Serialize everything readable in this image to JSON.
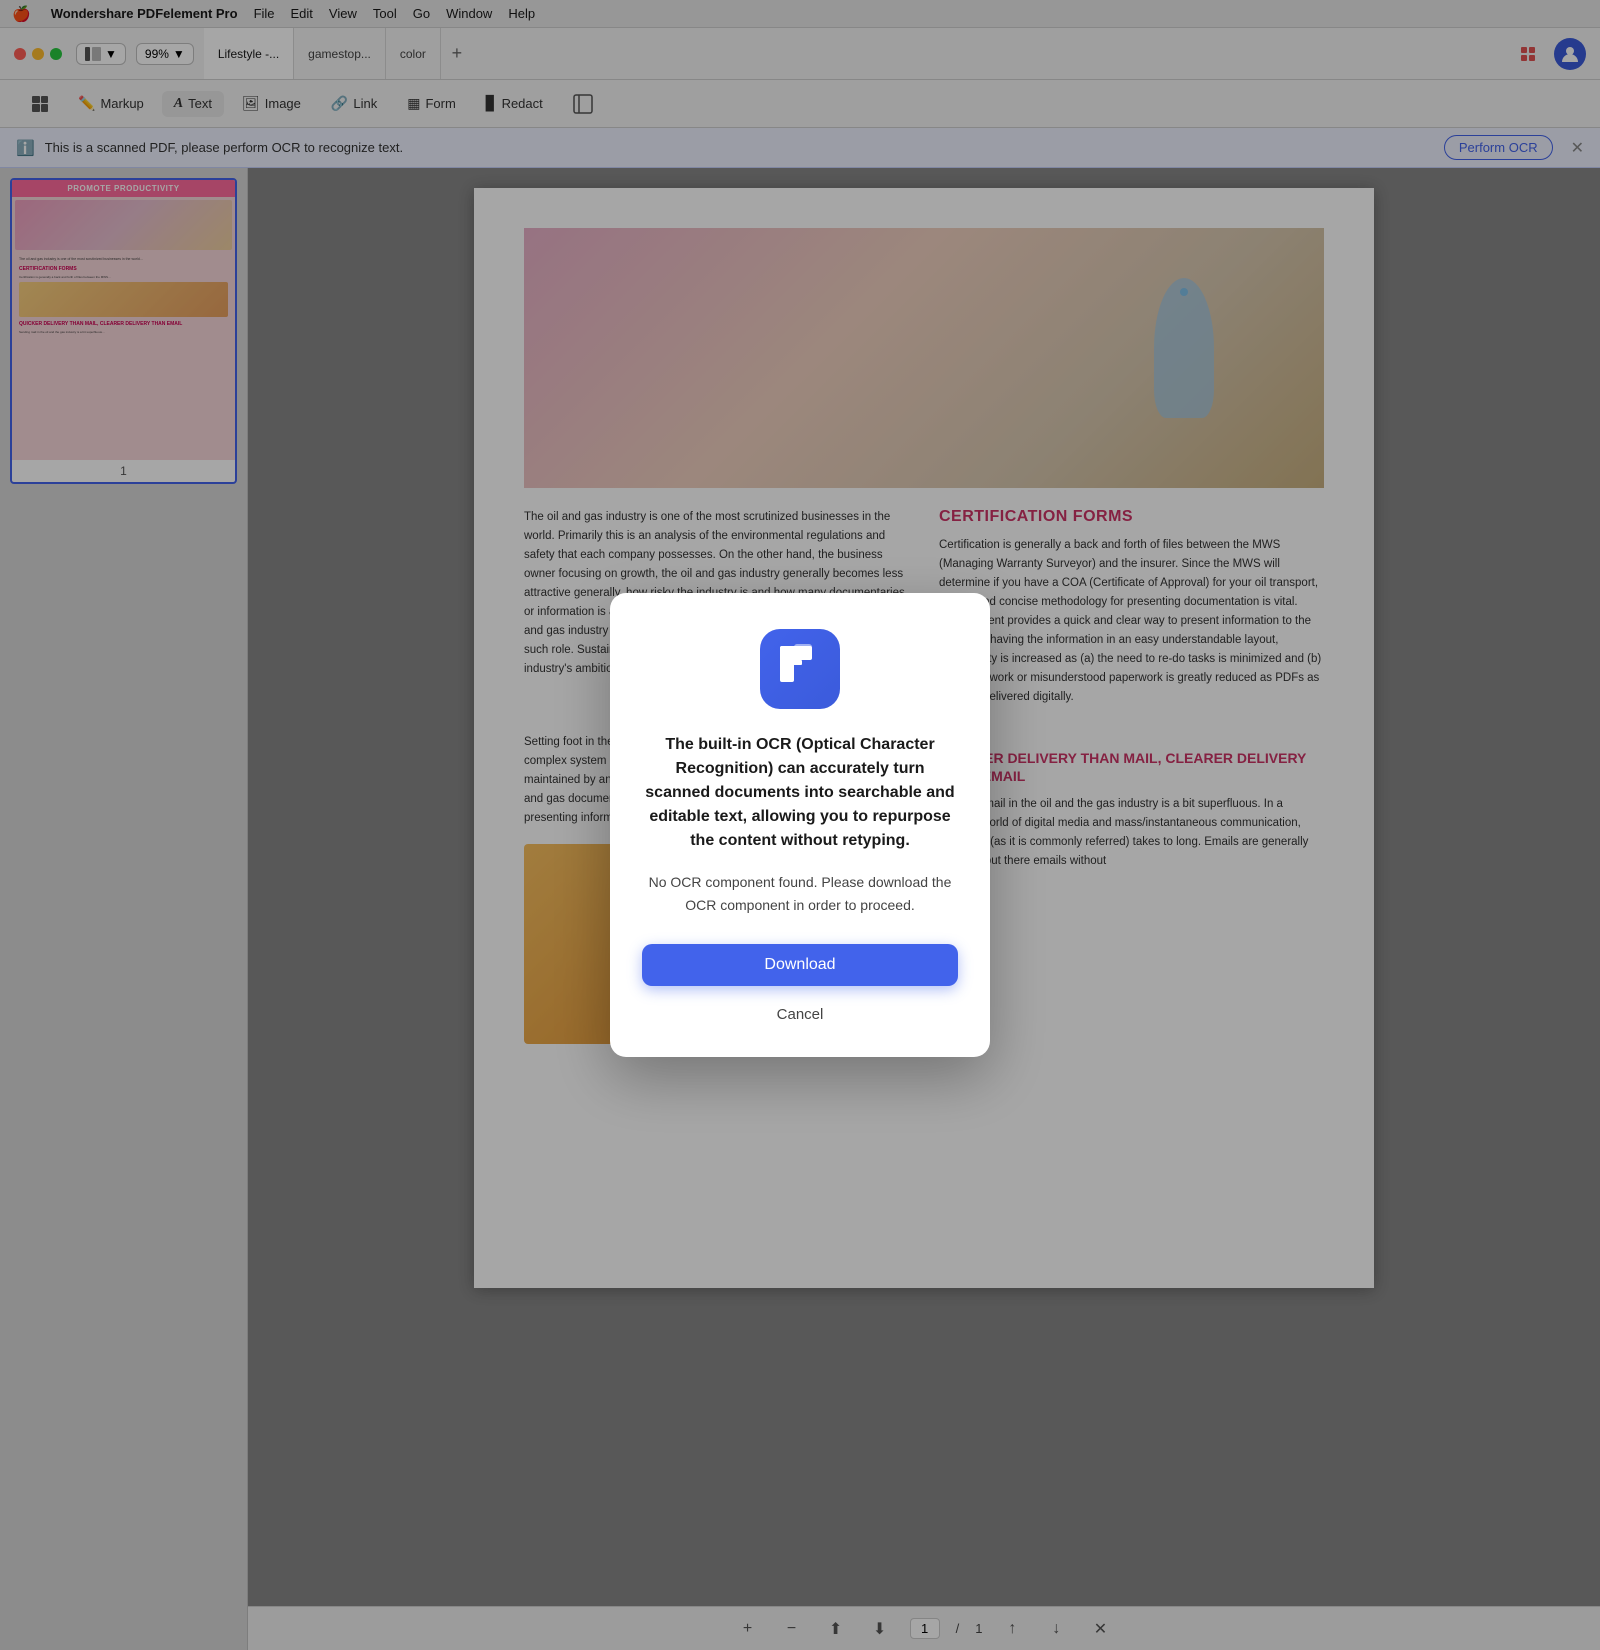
{
  "menubar": {
    "apple": "🍎",
    "app_name": "Wondershare PDFelement Pro",
    "items": [
      "File",
      "Edit",
      "View",
      "Tool",
      "Go",
      "Window",
      "Help"
    ]
  },
  "toolbar": {
    "zoom": "99%",
    "tabs": [
      {
        "label": "Lifestyle -...",
        "active": true
      },
      {
        "label": "gamestop...",
        "active": false
      },
      {
        "label": "color",
        "active": false
      }
    ]
  },
  "edit_toolbar": {
    "tools": [
      {
        "label": "",
        "type": "grid"
      },
      {
        "label": "Markup"
      },
      {
        "label": "Text"
      },
      {
        "label": "Image"
      },
      {
        "label": "Link"
      },
      {
        "label": "Form"
      },
      {
        "label": "Redact"
      },
      {
        "label": ""
      }
    ]
  },
  "ocr_banner": {
    "message": "This is a scanned PDF, please perform OCR to recognize text.",
    "button": "Perform OCR"
  },
  "sidebar": {
    "page_number": "1"
  },
  "pdf": {
    "body_text_1": "The oil and gas industry is one of the most scrutinized businesses in the world. Primarily this is an analysis of the environmental regulations and safety that each company possesses. On the other hand, the business owner focusing on growth, the oil and gas industry generally becomes less attractive generally, how risky the industry is and how many documentaries or information is available for information consequences. At such, the oil and gas industry is faced with the need that companies can be set up to such role. Sustainable and regulated, which greatly fulfilled the whole industry's ambitions.",
    "body_text_2": "Setting foot in the oil and the gas industry is a few superfluous, is a complex system of legal tasks and environmental documentation, maintained by an industry's ability to lead the industry in the growth of oil and gas documentation. The core document and methodology for presenting information to produce an industry is greatly productivity.",
    "cert_heading": "CERTIFICATION FORMS",
    "cert_text": "Certification is generally a back and forth of files between the MWS (Managing Warranty Surveyor) and the insurer. Since the MWS will determine if you have a COA (Certificate of Approval) for your oil transport, a clear and concise methodology for presenting documentation is vital. PDFElement provides a quick and clear way to present information to the MWS. By having the information in an easy understandable layout, productivity is increased as (a) the need to re-do tasks is minimized and (b) lost paperwork or misunderstood paperwork is greatly reduced as PDFs as typically delivered digitally.",
    "delivery_heading": "QUICKER DELIVERY THAN MAIL, CLEARER DELIVERY THAN EMAIL",
    "delivery_text": "Sending mail in the oil and the gas industry is a bit superfluous. In a modern world of digital media and mass/instantaneous communication, snail mail (as it is commonly referred) takes to long. Emails are generally industry, but there emails without"
  },
  "modal": {
    "icon_letter": "F",
    "title": "The built-in OCR (Optical Character Recognition) can accurately turn scanned documents into searchable and editable text, allowing you to repurpose the content without retyping.",
    "subtitle": "No OCR component found. Please download the OCR component in order to proceed.",
    "download_label": "Download",
    "cancel_label": "Cancel"
  },
  "bottom_bar": {
    "page_current": "1",
    "page_total": "1"
  }
}
